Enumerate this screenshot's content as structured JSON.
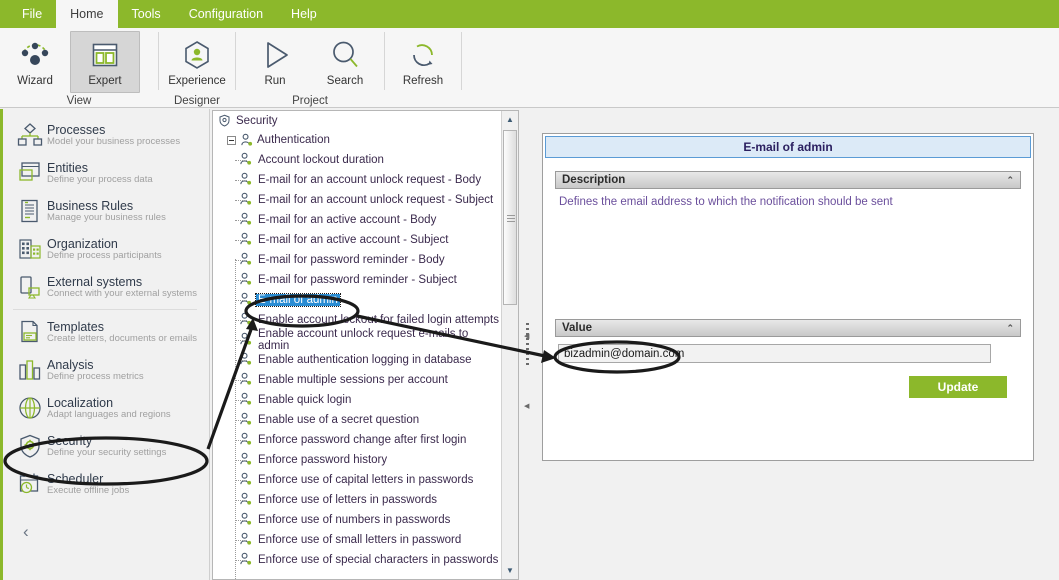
{
  "menubar": {
    "items": [
      {
        "label": "File",
        "active": false
      },
      {
        "label": "Home",
        "active": true
      },
      {
        "label": "Tools",
        "active": false
      },
      {
        "label": "Configuration",
        "active": false
      },
      {
        "label": "Help",
        "active": false
      }
    ]
  },
  "ribbon": {
    "groups": [
      {
        "label": "View",
        "buttons": [
          {
            "label": "Wizard",
            "icon": "nodes-icon",
            "selected": false
          },
          {
            "label": "Expert",
            "icon": "window-layout-icon",
            "selected": true
          }
        ]
      },
      {
        "label": "Designer",
        "buttons": [
          {
            "label": "Experience",
            "icon": "user-hexagon-icon",
            "selected": false
          }
        ]
      },
      {
        "label": "Project",
        "buttons": [
          {
            "label": "Run",
            "icon": "play-triangle-icon",
            "selected": false
          },
          {
            "label": "Search",
            "icon": "magnifier-icon",
            "selected": false
          }
        ]
      },
      {
        "label": "",
        "buttons": [
          {
            "label": "Refresh",
            "icon": "refresh-circular-arrow-icon",
            "selected": false
          }
        ]
      }
    ]
  },
  "sidebar": {
    "items": [
      {
        "title": "Processes",
        "subtitle": "Model your business processes",
        "icon": "process-diagram-icon"
      },
      {
        "title": "Entities",
        "subtitle": "Define your process data",
        "icon": "entities-window-icon"
      },
      {
        "title": "Business Rules",
        "subtitle": "Manage your business rules",
        "icon": "rules-document-icon"
      },
      {
        "title": "Organization",
        "subtitle": "Define process participants",
        "icon": "organization-building-icon"
      },
      {
        "title": "External systems",
        "subtitle": "Connect with your external systems",
        "icon": "external-systems-icon"
      },
      {
        "title": "Templates",
        "subtitle": "Create letters, documents  or emails",
        "icon": "templates-page-icon"
      },
      {
        "title": "Analysis",
        "subtitle": "Define  process  metrics",
        "icon": "analysis-bars-icon"
      },
      {
        "title": "Localization",
        "subtitle": "Adapt  languages  and regions",
        "icon": "localization-globe-icon"
      },
      {
        "title": "Security",
        "subtitle": "Define  your  security  settings",
        "icon": "security-shield-icon"
      },
      {
        "title": "Scheduler",
        "subtitle": "Execute offline  jobs",
        "icon": "scheduler-calendar-icon"
      }
    ],
    "collapse_glyph": "‹"
  },
  "tree": {
    "root": {
      "label": "Security",
      "icon": "security-shield-icon"
    },
    "group": {
      "label": "Authentication",
      "icon": "user-key-icon",
      "expanded": true
    },
    "leaves": [
      {
        "label": "Account lockout duration",
        "selected": false
      },
      {
        "label": "E-mail for an account unlock request - Body",
        "selected": false
      },
      {
        "label": "E-mail for an account unlock request - Subject",
        "selected": false
      },
      {
        "label": "E-mail for an active account - Body",
        "selected": false
      },
      {
        "label": "E-mail for an active account - Subject",
        "selected": false
      },
      {
        "label": "E-mail for password reminder - Body",
        "selected": false
      },
      {
        "label": "E-mail for password reminder - Subject",
        "selected": false
      },
      {
        "label": "E-mail of admin",
        "selected": true
      },
      {
        "label": "Enable account lockout for failed login attempts",
        "selected": false
      },
      {
        "label": "Enable account unlock request e-mails to admin",
        "selected": false
      },
      {
        "label": "Enable authentication logging in database",
        "selected": false
      },
      {
        "label": "Enable multiple sessions per account",
        "selected": false
      },
      {
        "label": "Enable quick login",
        "selected": false
      },
      {
        "label": "Enable use of a secret question",
        "selected": false
      },
      {
        "label": "Enforce password change after first login",
        "selected": false
      },
      {
        "label": "Enforce password history",
        "selected": false
      },
      {
        "label": "Enforce use of capital letters in passwords",
        "selected": false
      },
      {
        "label": "Enforce use of letters in passwords",
        "selected": false
      },
      {
        "label": "Enforce use of numbers in passwords",
        "selected": false
      },
      {
        "label": "Enforce use of small letters in password",
        "selected": false
      },
      {
        "label": "Enforce use of special characters in passwords",
        "selected": false
      }
    ],
    "scroll_up_glyph": "▲",
    "scroll_down_glyph": "▼"
  },
  "detail": {
    "title": "E-mail of admin",
    "description_section": {
      "header": "Description",
      "collapse_glyph": "⌃",
      "text": "Defines the email address to which  the notification should be sent"
    },
    "value_section": {
      "header": "Value",
      "collapse_glyph": "⌃",
      "input_value": "bizadmin@domain.com",
      "input_placeholder": "",
      "update_label": "Update"
    }
  },
  "colors": {
    "brand_green": "#8cb82b",
    "selection_blue": "#2a8dd4",
    "title_blue_border": "#5b9bd5",
    "title_blue_fill": "#dceaf7",
    "description_purple": "#6b4f9c",
    "annotation_black": "#1a1a1a"
  }
}
